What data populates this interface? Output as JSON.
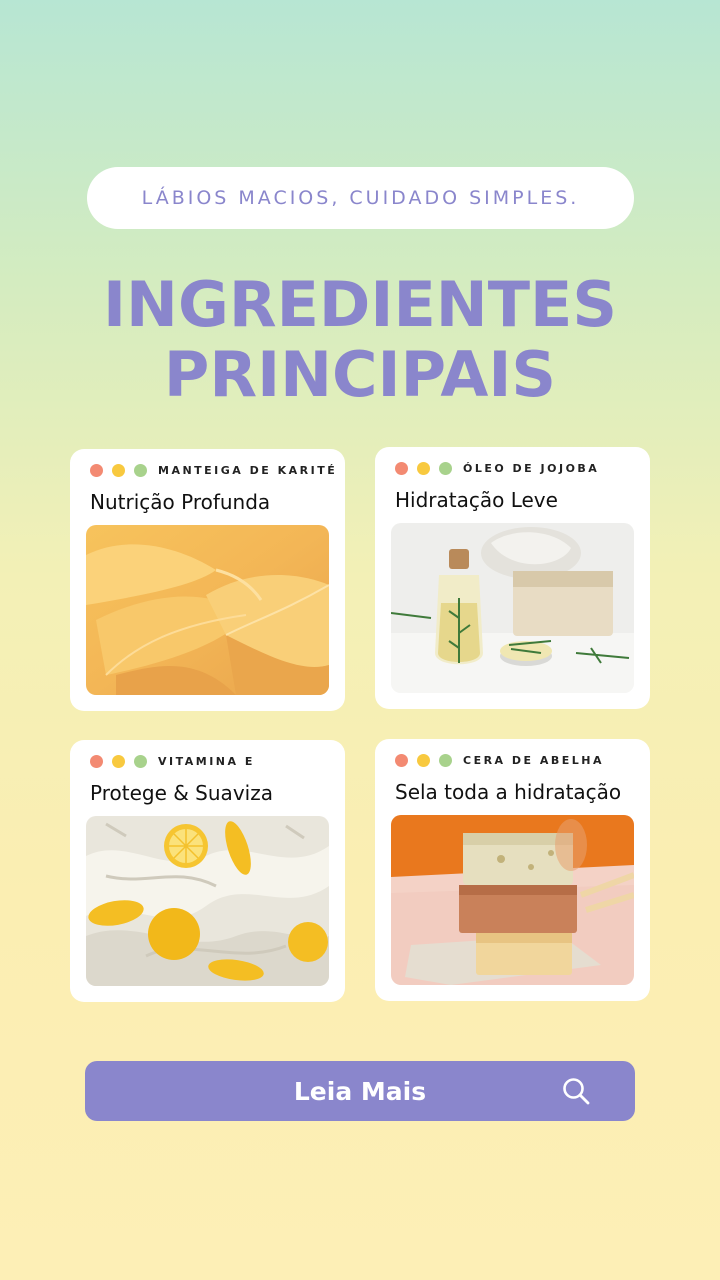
{
  "tagline": "LÁBIOS MACIOS, CUIDADO SIMPLES.",
  "title": {
    "line1": "INGREDIENTES",
    "line2": "PRINCIPAIS"
  },
  "cards": [
    {
      "label": "MANTEIGA DE KARITÉ",
      "heading": "Nutrição Profunda"
    },
    {
      "label": "ÓLEO DE JOJOBA",
      "heading": "Hidratação Leve"
    },
    {
      "label": "VITAMINA E",
      "heading": "Protege & Suaviza"
    },
    {
      "label": "CERA DE ABELHA",
      "heading": "Sela toda a hidratação"
    }
  ],
  "cta": {
    "label": "Leia Mais",
    "icon": "search-icon"
  },
  "colors": {
    "accent": "#8a86cc",
    "dot_red": "#f38a72",
    "dot_yellow": "#f8c93f",
    "dot_green": "#a8d28c"
  }
}
